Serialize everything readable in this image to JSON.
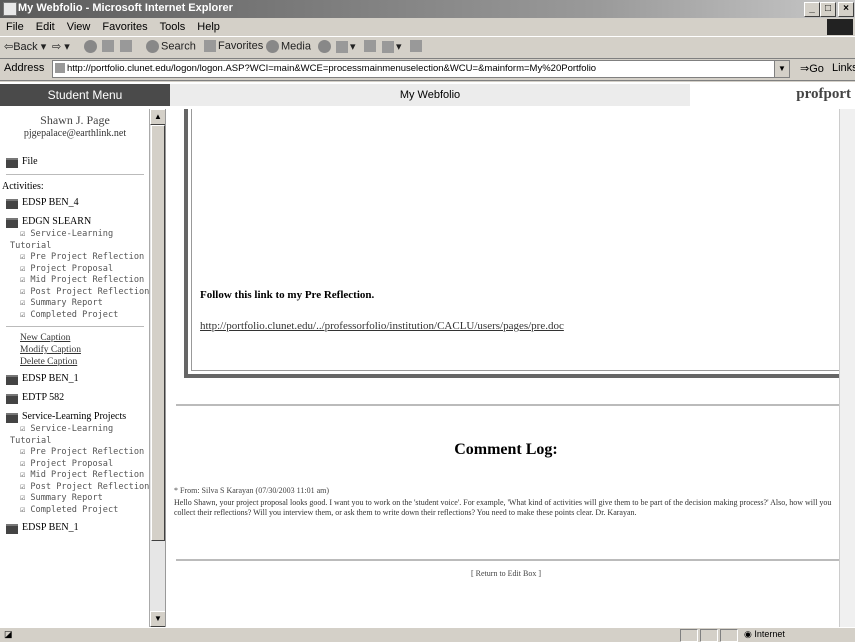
{
  "window": {
    "title": "My Webfolio - Microsoft Internet Explorer"
  },
  "menu": [
    "File",
    "Edit",
    "View",
    "Favorites",
    "Tools",
    "Help"
  ],
  "toolbar": {
    "back": "Back",
    "search": "Search",
    "favorites": "Favorites",
    "media": "Media"
  },
  "address": {
    "label": "Address",
    "url": "http://portfolio.clunet.edu/logon/logon.ASP?WCI=main&WCE=processmainmenuselection&WCU=&mainform=My%20Portfolio",
    "go": "Go",
    "links": "Links"
  },
  "header": {
    "menu_tab": "Student Menu",
    "site_title": "My Webfolio",
    "brand": "profport"
  },
  "sidebar": {
    "name": "Shawn J. Page",
    "email": "pjgepalace@earthlink.net",
    "file": "File",
    "activities_label": "Activities:",
    "folder1": "EDSP BEN_4",
    "folder2": "EDGN SLEARN",
    "subitems1": [
      "Service-Learning",
      "Tutorial",
      "Pre Project Reflection",
      "Project Proposal",
      "Mid Project Reflection",
      "Post Project Reflection",
      "Summary Report",
      "Completed Project"
    ],
    "caption_links": [
      "New Caption",
      "Modify Caption",
      "Delete Caption"
    ],
    "folder3": "EDSP BEN_1",
    "folder4": "EDTP 582",
    "folder5": "Service-Learning Projects",
    "subitems2": [
      "Service-Learning",
      "Tutorial",
      "Pre Project Reflection",
      "Project Proposal",
      "Mid Project Reflection",
      "Post Project Reflection",
      "Summary Report",
      "Completed Project"
    ],
    "folder6": "EDSP BEN_1"
  },
  "main": {
    "follow_text": "Follow this link to my Pre Reflection.",
    "link_url": "http://portfolio.clunet.edu/../professorfolio/institution/CACLU/users/pages/pre.doc",
    "log_title": "Comment Log:",
    "from_line": "* From: Silva S Karayan (07/30/2003 11:01 am)",
    "comment": "Hello Shawn, your project proposal looks good. I want you to work on the 'student voice'. For example, 'What kind of activities will give them to be part of the decision making process?' Also, how will you collect their reflections? Will you interview them, or ask them to write down their reflections? You need to make these points clear. Dr. Karayan.",
    "return_link": "[ Return to Edit Box ]"
  },
  "status": {
    "zone": "Internet"
  }
}
